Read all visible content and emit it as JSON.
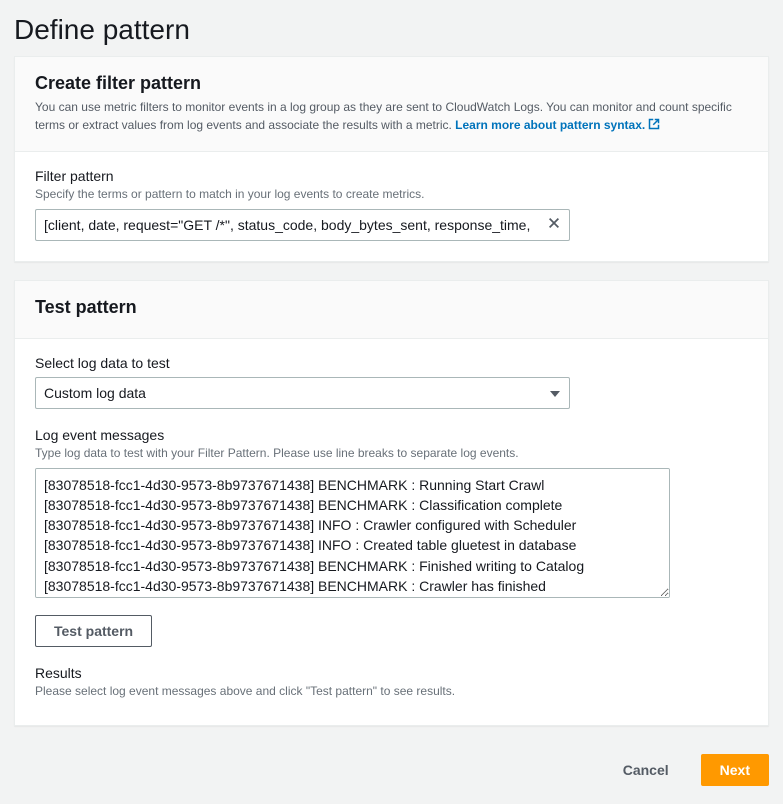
{
  "page": {
    "title": "Define pattern"
  },
  "createPanel": {
    "title": "Create filter pattern",
    "desc_prefix": "You can use metric filters to monitor events in a log group as they are sent to CloudWatch Logs. You can monitor and count specific terms or extract values from log events and associate the results with a metric. ",
    "link_text": "Learn more about pattern syntax.",
    "filter_label": "Filter pattern",
    "filter_hint": "Specify the terms or pattern to match in your log events to create metrics.",
    "filter_value": "[client, date, request=\"GET /*\", status_code, body_bytes_sent, response_time, ",
    "filter_placeholder": ""
  },
  "testPanel": {
    "title": "Test pattern",
    "select_label": "Select log data to test",
    "select_value": "Custom log data",
    "select_options": [
      "Custom log data"
    ],
    "log_label": "Log event messages",
    "log_hint": "Type log data to test with your Filter Pattern. Please use line breaks to separate log events.",
    "log_value": "[83078518-fcc1-4d30-9573-8b9737671438] BENCHMARK : Running Start Crawl\n[83078518-fcc1-4d30-9573-8b9737671438] BENCHMARK : Classification complete\n[83078518-fcc1-4d30-9573-8b9737671438] INFO : Crawler configured with Scheduler\n[83078518-fcc1-4d30-9573-8b9737671438] INFO : Created table gluetest in database\n[83078518-fcc1-4d30-9573-8b9737671438] BENCHMARK : Finished writing to Catalog\n[83078518-fcc1-4d30-9573-8b9737671438] BENCHMARK : Crawler has finished",
    "test_button": "Test pattern",
    "results_label": "Results",
    "results_hint": "Please select log event messages above and click \"Test pattern\" to see results."
  },
  "footer": {
    "cancel": "Cancel",
    "next": "Next"
  }
}
